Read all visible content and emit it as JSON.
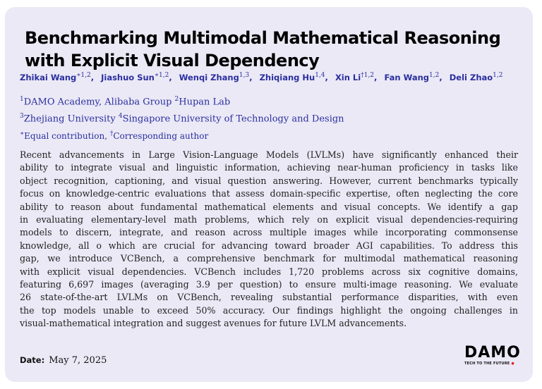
{
  "title": {
    "line1": "Benchmarking Multimodal Mathematical Reasoning",
    "line2": "with Explicit Visual Dependency"
  },
  "authors": [
    {
      "name": "Zhikai Wang",
      "marks": "∗1,2"
    },
    {
      "name": "Jiashuo Sun",
      "marks": "∗1,2"
    },
    {
      "name": "Wenqi Zhang",
      "marks": "1,3"
    },
    {
      "name": "Zhiqiang Hu",
      "marks": "1,4"
    },
    {
      "name": "Xin Li",
      "marks": "†1,2"
    },
    {
      "name": "Fan Wang",
      "marks": "1,2"
    },
    {
      "name": "Deli Zhao",
      "marks": "1,2"
    }
  ],
  "affiliations": {
    "a1_mark": "1",
    "a1": "DAMO Academy, Alibaba Group ",
    "a2_mark": "2",
    "a2": "Hupan Lab",
    "a3_mark": "3",
    "a3": "Zhejiang University ",
    "a4_mark": "4",
    "a4": "Singapore University of Technology and Design",
    "n1_mark": "∗",
    "n1": "Equal contribution, ",
    "n2_mark": "†",
    "n2": "Corresponding author"
  },
  "abstract_lines": [
    "Recent advancements in Large Vision-Language Models (LVLMs) have significantly enhanced their",
    "ability to integrate visual and linguistic information, achieving near-human proficiency in tasks like",
    "object recognition, captioning, and visual question answering. However, current benchmarks typically",
    "focus on knowledge-centric evaluations that assess domain-specific expertise, often neglecting the core",
    "ability to reason about fundamental mathematical elements and visual concepts. We identify a gap",
    "in evaluating elementary-level math problems, which rely on explicit visual dependencies-requiring",
    "models to discern, integrate, and reason across multiple images while incorporating commonsense",
    "knowledge, all o which are crucial for advancing toward broader AGI capabilities. To address this",
    "gap, we introduce VCBench, a comprehensive benchmark for multimodal mathematical reasoning",
    "with explicit visual dependencies. VCBench includes 1,720 problems across six cognitive domains,",
    "featuring 6,697 images (averaging 3.9 per question) to ensure multi-image reasoning. We evaluate",
    "26 state-of-the-art LVLMs on VCBench, revealing substantial performance disparities, with even",
    "the top models unable to exceed 50% accuracy. Our findings highlight the ongoing challenges in",
    "visual-mathematical integration and suggest avenues for future LVLM advancements."
  ],
  "date": {
    "label": "Date:",
    "value": "May 7, 2025"
  },
  "logo": {
    "word": "DAMO",
    "tagline": "TECH TO THE FUTURE",
    "accent": "#e0262b"
  },
  "colors": {
    "card_bg": "#ebe9f6",
    "author_color": "#2b2f9e"
  }
}
